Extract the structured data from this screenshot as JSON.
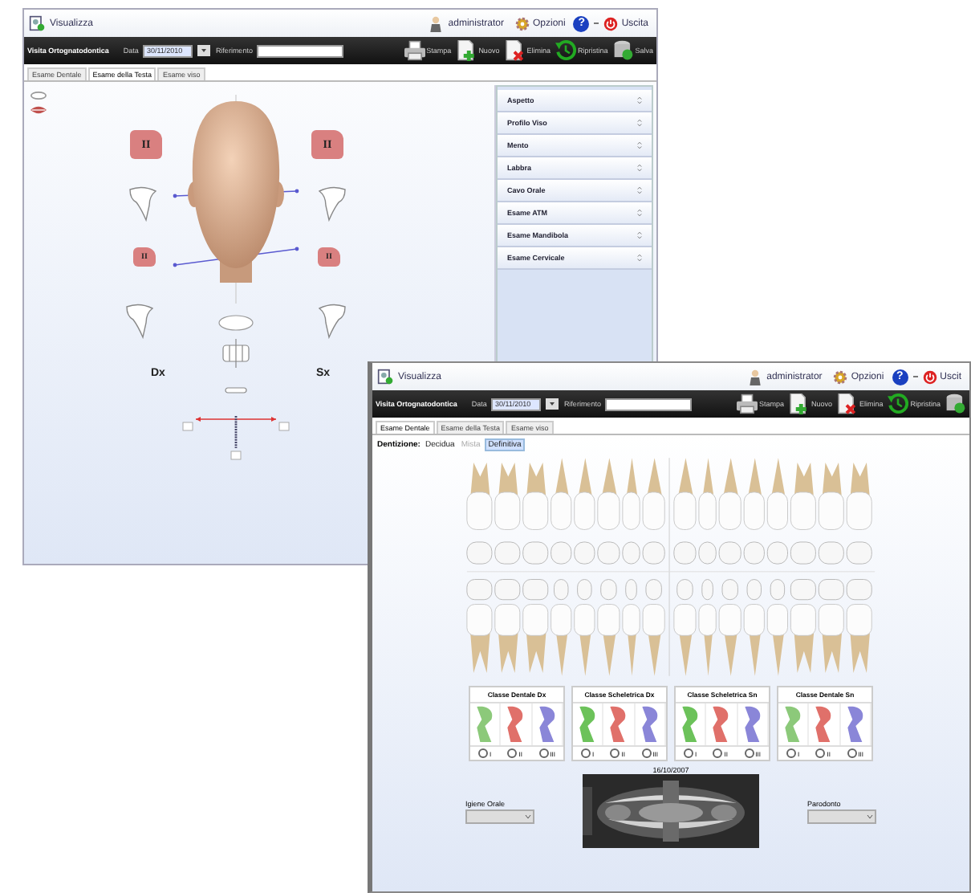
{
  "windows": [
    {
      "kind": "head_exam",
      "title": "Visualizza",
      "user": "administrator",
      "options": "Opzioni",
      "help": "?",
      "exit": "Uscita",
      "form_title": "Visita Ortognatodontica",
      "date_label": "Data",
      "date": "30/11/2010",
      "reference_label": "Riferimento",
      "actions": [
        {
          "kind": "print",
          "label": "Stampa"
        },
        {
          "kind": "new",
          "label": "Nuovo"
        },
        {
          "kind": "delete",
          "label": "Elimina"
        },
        {
          "kind": "restore",
          "label": "Ripristina"
        },
        {
          "kind": "save",
          "label": "Salva"
        }
      ],
      "tabs": [
        {
          "label": "Esame Dentale",
          "selected": false
        },
        {
          "label": "Esame della Testa",
          "selected": true
        },
        {
          "label": "Esame viso",
          "selected": false
        }
      ],
      "face_marks": [
        {
          "label": "II"
        },
        {
          "label": "II"
        },
        {
          "label": "II"
        },
        {
          "label": "II"
        }
      ],
      "side_labels": [
        "Dx",
        "Sx"
      ],
      "sections": [
        {
          "label": "Aspetto"
        },
        {
          "label": "Profilo Viso"
        },
        {
          "label": "Mento"
        },
        {
          "label": "Labbra"
        },
        {
          "label": "Cavo Orale"
        },
        {
          "label": "Esame ATM"
        },
        {
          "label": "Esame Mandibola"
        },
        {
          "label": "Esame Cervicale"
        }
      ]
    },
    {
      "kind": "dental_exam",
      "title": "Visualizza",
      "user": "administrator",
      "options": "Opzioni",
      "help": "?",
      "exit": "Uscit",
      "form_title": "Visita Ortognatodontica",
      "date_label": "Data",
      "date": "30/11/2010",
      "reference_label": "Riferimento",
      "actions": [
        {
          "kind": "print",
          "label": "Stampa"
        },
        {
          "kind": "new",
          "label": "Nuovo"
        },
        {
          "kind": "delete",
          "label": "Elimina"
        },
        {
          "kind": "restore",
          "label": "Ripristina"
        },
        {
          "kind": "save"
        }
      ],
      "tabs": [
        {
          "label": "Esame Dentale",
          "selected": true
        },
        {
          "label": "Esame della Testa",
          "selected": false
        },
        {
          "label": "Esame viso",
          "selected": false
        }
      ],
      "dentition": {
        "label": "Dentizione:",
        "options": [
          {
            "label": "Decidua",
            "selected": false,
            "disabled": false
          },
          {
            "label": "Mista",
            "selected": false,
            "disabled": true
          },
          {
            "label": "Definitiva",
            "selected": true,
            "disabled": false
          }
        ]
      },
      "classes": [
        {
          "title": "Classe Dentale Dx",
          "options": [
            {
              "label": "I",
              "checked": false,
              "color": "#8cc97a"
            },
            {
              "label": "II",
              "checked": false,
              "color": "#e0706a"
            },
            {
              "label": "III",
              "checked": false,
              "color": "#8a86d8"
            }
          ]
        },
        {
          "title": "Classe Scheletrica Dx",
          "options": [
            {
              "label": "I",
              "checked": false,
              "color": "#6cc25a"
            },
            {
              "label": "II",
              "checked": false,
              "color": "#e0706a"
            },
            {
              "label": "III",
              "checked": false,
              "color": "#8a86d8"
            }
          ]
        },
        {
          "title": "Classe Scheletrica Sn",
          "options": [
            {
              "label": "I",
              "checked": false,
              "color": "#6cc25a"
            },
            {
              "label": "II",
              "checked": false,
              "color": "#e0706a"
            },
            {
              "label": "III",
              "checked": false,
              "color": "#8a86d8"
            }
          ]
        },
        {
          "title": "Classe Dentale Sn",
          "options": [
            {
              "label": "I",
              "checked": false,
              "color": "#8cc97a"
            },
            {
              "label": "II",
              "checked": false,
              "color": "#e0706a"
            },
            {
              "label": "III",
              "checked": false,
              "color": "#8a86d8"
            }
          ]
        }
      ],
      "xray": {
        "date": "16/10/2007"
      },
      "selects": [
        {
          "label": "Igiene Orale"
        },
        {
          "label": "Parodonto"
        }
      ]
    }
  ]
}
